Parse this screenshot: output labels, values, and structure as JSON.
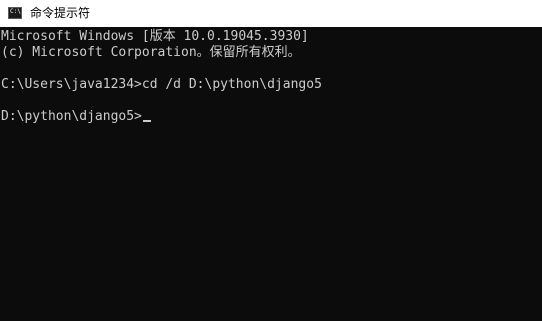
{
  "window": {
    "title": "命令提示符",
    "icon": "cmd-icon",
    "icon_text": "C:\\"
  },
  "console": {
    "lines": [
      "Microsoft Windows [版本 10.0.19045.3930]",
      "(c) Microsoft Corporation。保留所有权利。",
      "C:\\Users\\java1234>cd /d D:\\python\\django5",
      "D:\\python\\django5>"
    ]
  },
  "colors": {
    "background": "#0c0c0c",
    "foreground": "#cccccc",
    "titlebar": "#ffffff"
  }
}
